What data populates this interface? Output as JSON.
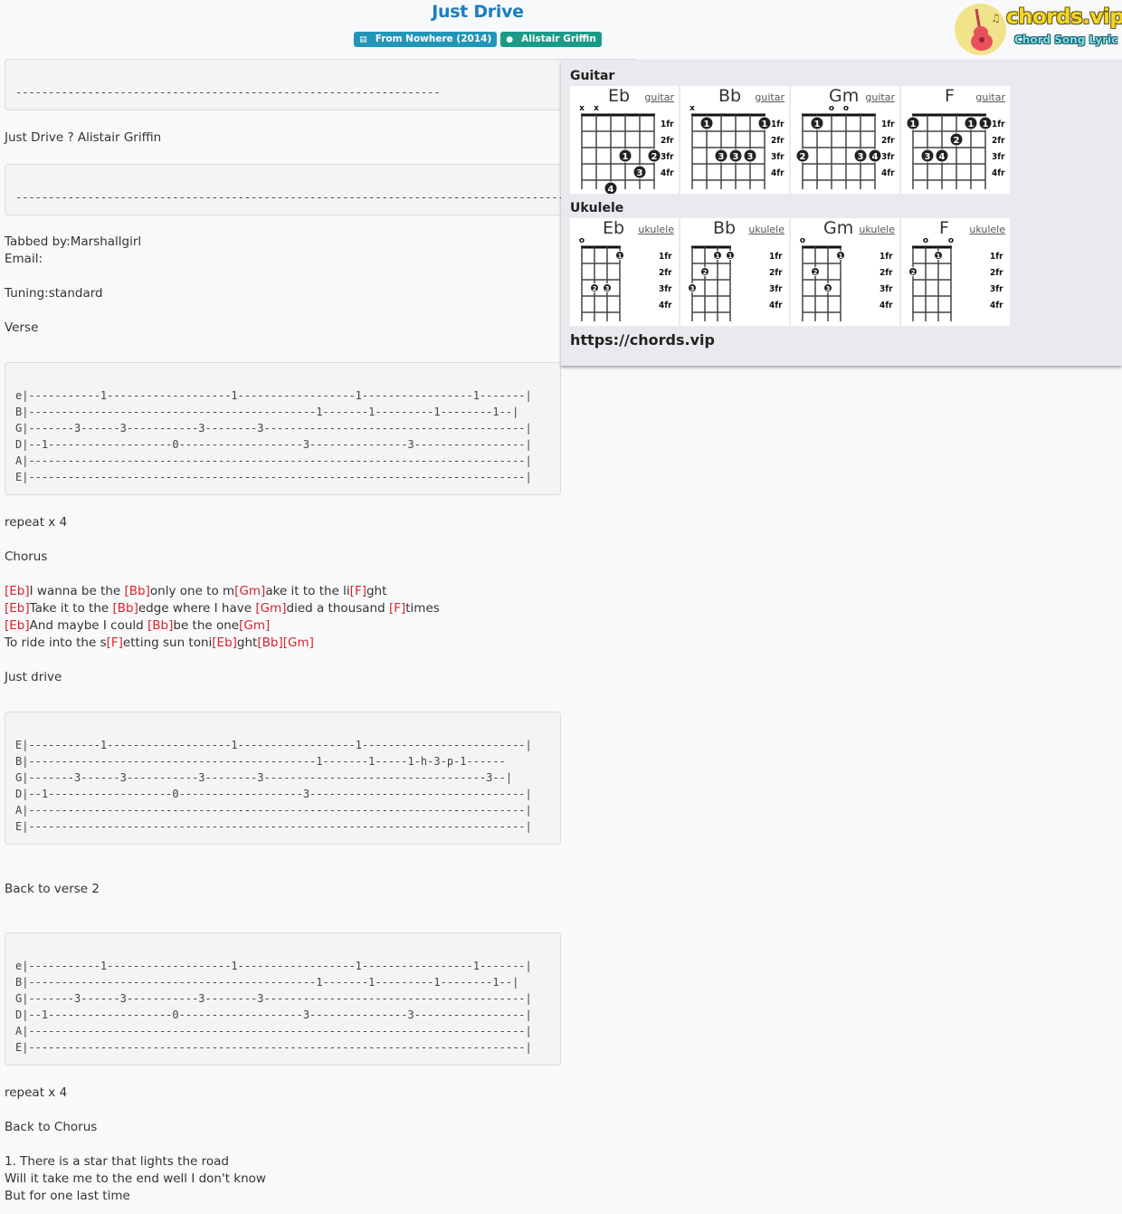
{
  "header": {
    "title": "Just Drive",
    "album_badge": "From Nowhere (2014)",
    "artist_badge": "Alistair Griffin",
    "album_icon": "book-icon",
    "artist_icon": "user-icon"
  },
  "logo": {
    "word": "chords.vip",
    "tagline": "Chord Song Lyric"
  },
  "song": {
    "tab_block_1": [
      "",
      "-----------------------------------------------------------------"
    ],
    "credit_line": "Just Drive ? Alistair Griffin",
    "tab_block_2": [
      "",
      "---------------------------------------------------------------------------------------------"
    ],
    "info_lines": [
      "Tabbed by:Marshallgirl",
      "Email:",
      "",
      "Tuning:standard",
      "",
      "Verse"
    ],
    "verse_tab": [
      "",
      "e|-----------1-------------------1------------------1-----------------1-------|",
      "B|--------------------------------------------1-------1---------1--------1--|",
      "G|-------3------3-----------3--------3----------------------------------------|",
      "D|--1-------------------0-------------------3---------------3-----------------|",
      "A|----------------------------------------------------------------------------|",
      "E|----------------------------------------------------------------------------|"
    ],
    "repeat_1": "repeat x 4",
    "chorus_label": "Chorus",
    "chorus_lines": [
      [
        {
          "c": "[Eb]"
        },
        {
          "t": "I wanna be the "
        },
        {
          "c": "[Bb]"
        },
        {
          "t": "only one to m"
        },
        {
          "c": "[Gm]"
        },
        {
          "t": "ake it to the li"
        },
        {
          "c": "[F]"
        },
        {
          "t": "ght"
        }
      ],
      [
        {
          "c": "[Eb]"
        },
        {
          "t": "Take it to the "
        },
        {
          "c": "[Bb]"
        },
        {
          "t": "edge where I have "
        },
        {
          "c": "[Gm]"
        },
        {
          "t": "died a thousand "
        },
        {
          "c": "[F]"
        },
        {
          "t": "times"
        }
      ],
      [
        {
          "c": "[Eb]"
        },
        {
          "t": "And maybe I could "
        },
        {
          "c": "[Bb]"
        },
        {
          "t": "be the one"
        },
        {
          "c": "[Gm]"
        }
      ],
      [
        {
          "t": "To ride into the s"
        },
        {
          "c": "[F]"
        },
        {
          "t": "etting sun toni"
        },
        {
          "c": "[Eb]"
        },
        {
          "t": "ght"
        },
        {
          "c": "[Bb]"
        },
        {
          "c": "[Gm]"
        }
      ]
    ],
    "just_drive": "Just drive",
    "chorus_tab": [
      "",
      "E|-----------1-------------------1------------------1-------------------------|",
      "B|--------------------------------------------1-------1-----1-h-3-p-1------",
      "G|-------3------3-----------3--------3----------------------------------3--|",
      "D|--1-------------------0-------------------3---------------------------------|",
      "A|----------------------------------------------------------------------------|",
      "E|----------------------------------------------------------------------------|"
    ],
    "back_to_verse": "Back to verse 2",
    "verse2_tab": [
      "",
      "e|-----------1-------------------1------------------1-----------------1-------|",
      "B|--------------------------------------------1-------1---------1--------1--|",
      "G|-------3------3-----------3--------3----------------------------------------|",
      "D|--1-------------------0-------------------3---------------3-----------------|",
      "A|----------------------------------------------------------------------------|",
      "E|----------------------------------------------------------------------------|"
    ],
    "repeat_2": "repeat x 4",
    "back_to_chorus": "Back to Chorus",
    "outro_lines": [
      "1. There is a star that lights the road",
      "Will it take me to the end well I don't know",
      "But for one last time"
    ]
  },
  "chord_panel": {
    "guitar_heading": "Guitar",
    "ukulele_heading": "Ukulele",
    "site_url": "https://chords.vip",
    "fret_labels": [
      "1fr",
      "2fr",
      "3fr",
      "4fr"
    ],
    "guitar": [
      {
        "name": "Eb",
        "link": "guitar",
        "markers": [
          "x",
          "x",
          "",
          "",
          "",
          ""
        ],
        "dots": [
          {
            "s": 3,
            "f": 3,
            "n": "1"
          },
          {
            "s": 5,
            "f": 3,
            "n": "2"
          },
          {
            "s": 4,
            "f": 4,
            "n": "3"
          },
          {
            "s": 2,
            "f": 5,
            "n": "4"
          }
        ]
      },
      {
        "name": "Bb",
        "link": "guitar",
        "markers": [
          "x",
          "",
          "",
          "",
          "",
          ""
        ],
        "dots": [
          {
            "s": 1,
            "f": 1,
            "n": "1"
          },
          {
            "s": 5,
            "f": 1,
            "n": "1"
          },
          {
            "s": 2,
            "f": 3,
            "n": "3"
          },
          {
            "s": 3,
            "f": 3,
            "n": "3"
          },
          {
            "s": 4,
            "f": 3,
            "n": "3"
          }
        ]
      },
      {
        "name": "Gm",
        "link": "guitar",
        "markers": [
          "",
          "",
          "o",
          "o",
          "",
          ""
        ],
        "dots": [
          {
            "s": 1,
            "f": 1,
            "n": "1"
          },
          {
            "s": 0,
            "f": 3,
            "n": "2"
          },
          {
            "s": 4,
            "f": 3,
            "n": "3"
          },
          {
            "s": 5,
            "f": 3,
            "n": "4"
          }
        ]
      },
      {
        "name": "F",
        "link": "guitar",
        "markers": [
          "",
          "",
          "",
          "",
          "",
          ""
        ],
        "dots": [
          {
            "s": 0,
            "f": 1,
            "n": "1"
          },
          {
            "s": 4,
            "f": 1,
            "n": "1"
          },
          {
            "s": 5,
            "f": 1,
            "n": "1"
          },
          {
            "s": 3,
            "f": 2,
            "n": "2"
          },
          {
            "s": 1,
            "f": 3,
            "n": "3"
          },
          {
            "s": 2,
            "f": 3,
            "n": "4"
          }
        ]
      }
    ],
    "ukulele": [
      {
        "name": "Eb",
        "link": "ukulele",
        "markers": [
          "o",
          "",
          "",
          ""
        ],
        "dots": [
          {
            "s": 3,
            "f": 1,
            "n": "1"
          },
          {
            "s": 1,
            "f": 3,
            "n": "2"
          },
          {
            "s": 2,
            "f": 3,
            "n": "3"
          }
        ]
      },
      {
        "name": "Bb",
        "link": "ukulele",
        "markers": [
          "",
          "",
          "",
          ""
        ],
        "dots": [
          {
            "s": 2,
            "f": 1,
            "n": "1"
          },
          {
            "s": 3,
            "f": 1,
            "n": "1"
          },
          {
            "s": 1,
            "f": 2,
            "n": "2"
          },
          {
            "s": 0,
            "f": 3,
            "n": "3"
          }
        ]
      },
      {
        "name": "Gm",
        "link": "ukulele",
        "markers": [
          "o",
          "",
          "",
          ""
        ],
        "dots": [
          {
            "s": 3,
            "f": 1,
            "n": "1"
          },
          {
            "s": 1,
            "f": 2,
            "n": "2"
          },
          {
            "s": 2,
            "f": 3,
            "n": "3"
          }
        ]
      },
      {
        "name": "F",
        "link": "ukulele",
        "markers": [
          "",
          "o",
          "",
          "o"
        ],
        "dots": [
          {
            "s": 2,
            "f": 1,
            "n": "1"
          },
          {
            "s": 0,
            "f": 2,
            "n": "2"
          }
        ]
      }
    ]
  }
}
